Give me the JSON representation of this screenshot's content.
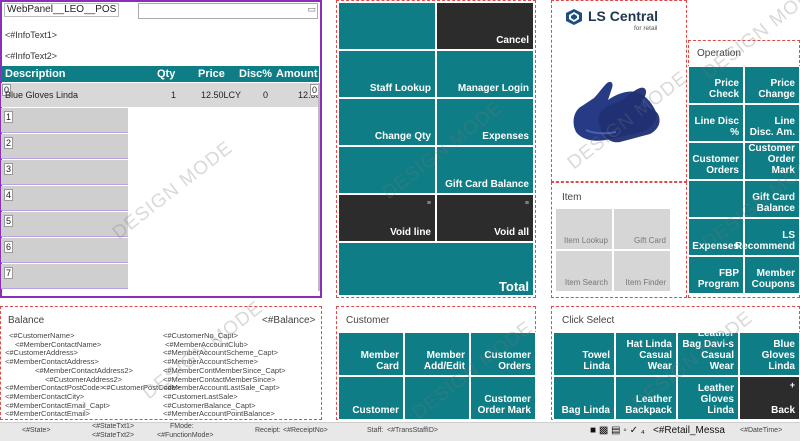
{
  "titlebar": {
    "panel_name": "WebPanel__LEO__POS",
    "keyboard_icon": "keyboard-icon"
  },
  "info": {
    "text1": "<#InfoText1>",
    "text2": "<#InfoText2>"
  },
  "grid": {
    "columns": [
      "Description",
      "Qty",
      "Price",
      "Disc%",
      "Amount"
    ],
    "rows": [
      {
        "num": "0",
        "description": "Blue Gloves Linda",
        "qty": "1",
        "price": "12.50LCY",
        "disc": "0",
        "amount": "12.50",
        "amount_marker": "0"
      }
    ],
    "row_numbers": [
      "1",
      "2",
      "3",
      "4",
      "5",
      "6",
      "7"
    ]
  },
  "center_buttons": {
    "cancel": "Cancel",
    "staff_lookup": "Staff Lookup",
    "manager_login": "Manager Login",
    "change_qty": "Change Qty",
    "expenses": "Expenses",
    "gift_card_balance": "Gift Card Balance",
    "void_line": "Void line",
    "void_all": "Void all",
    "total": "Total",
    "marker": "≡"
  },
  "logo": {
    "brand_prefix": "LS Ce",
    "brand_suffix": "ntral",
    "tagline": "for retail"
  },
  "item_panel": {
    "title": "Item",
    "buttons": [
      "Item Lookup",
      "Gift Card",
      "Item Search",
      "Item Finder"
    ]
  },
  "operation_panel": {
    "title": "Operation",
    "buttons": [
      "Price Check",
      "Price Change",
      "Line Disc %",
      "Line Disc. Am.",
      "Customer Orders",
      "Customer Order Mark",
      "",
      "Gift Card Balance",
      "Expenses",
      "LS Recommend",
      "FBP Program",
      "Member Coupons"
    ]
  },
  "balance": {
    "label": "Balance",
    "value": "<#Balance>"
  },
  "member_left": [
    "<#CustomerName>",
    "<#MemberContactName>",
    "<#CustomerAddress>",
    "<#MemberContactAddress>",
    "<#MemberContactAddress2>",
    "<#CustomerAddress2>",
    "<#MemberContactPostCode>",
    "<#MemberContactCity>",
    "<#CustomerPostCode>",
    "<#MemberContactEmail_Capt>",
    "<#MemberContactEmail>"
  ],
  "member_right": [
    "<#CustomerNo_Capt>",
    "<#MemberAccountClub>",
    "<#MemberAccountScheme_Capt>",
    "<#MemberAccountScheme>",
    "<#MemberContMemberSince_Capt>",
    "<#MemberContactMemberSince>",
    "<#MemberAccountLastSale_Capt>",
    "<#CustomerLastSale>",
    "<#CustomerBalance_Capt>",
    "<#MemberAccountPointBalance>"
  ],
  "customer_panel": {
    "title": "Customer",
    "buttons": [
      "Member Card",
      "Member Add/Edit",
      "Customer Orders",
      "Customer",
      "",
      "Customer Order Mark"
    ]
  },
  "click_select": {
    "title": "Click Select",
    "buttons": [
      "Towel Linda",
      "Hat Linda Casual Wear",
      "Leather Bag Davi-s Casual Wear",
      "Blue Gloves Linda",
      "Bag Linda",
      "Leather Backpack",
      "Leather Gloves Linda",
      "Back"
    ],
    "plus": "+"
  },
  "status": {
    "state": "<#State>",
    "state_txt1": "<#StateTxt1>",
    "state_txt2": "<#StateTxt2>",
    "fmode": "FMode:",
    "function_mode": "<#FunctionMode>",
    "receipt": "Receipt:",
    "receipt_no": "<#ReceiptNo>",
    "staff": "Staff:",
    "staff_id": "<#TransStaffID>",
    "retail_message": "<#Retail_Messa",
    "datetime": "<#DateTime>"
  },
  "watermark": "DESIGN MODE",
  "colors": {
    "teal": "#0e7d85",
    "dark": "#2c2c2c",
    "dash": "#e24a4a",
    "frame": "#8b2fb8"
  }
}
